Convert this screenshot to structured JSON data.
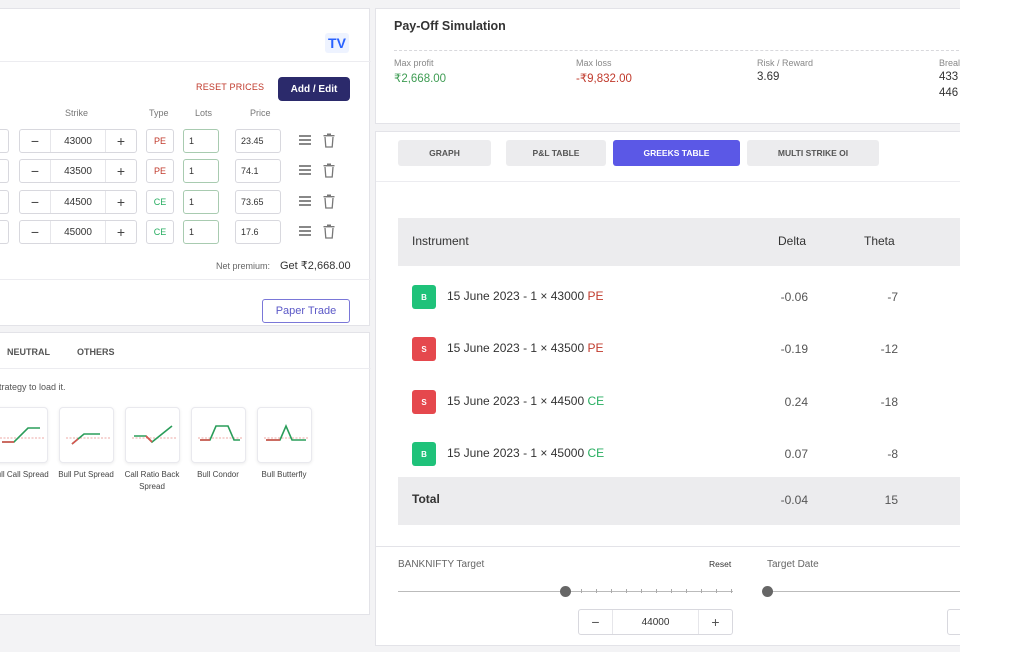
{
  "builder": {
    "reset_prices": "RESET PRICES",
    "add_edit": "Add / Edit",
    "columns": {
      "strike": "Strike",
      "type": "Type",
      "lots": "Lots",
      "price": "Price"
    },
    "legs": [
      {
        "strike": "43000",
        "type": "PE",
        "lots": "1",
        "price": "23.45"
      },
      {
        "strike": "43500",
        "type": "PE",
        "lots": "1",
        "price": "74.1"
      },
      {
        "strike": "44500",
        "type": "CE",
        "lots": "1",
        "price": "73.65"
      },
      {
        "strike": "45000",
        "type": "CE",
        "lots": "1",
        "price": "17.6"
      }
    ],
    "minus": "−",
    "plus": "+",
    "net_premium_label": "Net premium:",
    "net_premium_value": "Get ₹2,668.00",
    "paper_trade": "Paper Trade"
  },
  "strategies": {
    "tabs": [
      "NEUTRAL",
      "OTHERS"
    ],
    "hint": "trategy to load it.",
    "cards": [
      {
        "label": "Bull Call Spread",
        "icon": "bull-call-spread-icon"
      },
      {
        "label": "Bull Put Spread",
        "icon": "bull-put-spread-icon"
      },
      {
        "label": "Call Ratio Back Spread",
        "icon": "call-ratio-back-spread-icon"
      },
      {
        "label": "Bull Condor",
        "icon": "bull-condor-icon"
      },
      {
        "label": "Bull Butterfly",
        "icon": "bull-butterfly-icon"
      }
    ]
  },
  "payoff": {
    "title": "Pay-Off Simulation",
    "max_profit_label": "Max profit",
    "max_profit": "₹2,668.00",
    "max_loss_label": "Max loss",
    "max_loss": "-₹9,832.00",
    "risk_reward_label": "Risk / Reward",
    "risk_reward": "3.69",
    "breakeven_label": "Breal",
    "breakeven_1": "433",
    "breakeven_2": "446"
  },
  "tabs": [
    "GRAPH",
    "P&L TABLE",
    "GREEKS TABLE",
    "MULTI STRIKE OI"
  ],
  "active_tab": "GREEKS TABLE",
  "greeks": {
    "headers": {
      "instrument": "Instrument",
      "delta": "Delta",
      "theta": "Theta"
    },
    "rows": [
      {
        "side": "B",
        "text": "15 June 2023 - 1 × 43000 ",
        "type": "PE",
        "delta": "-0.06",
        "theta": "-7"
      },
      {
        "side": "S",
        "text": "15 June 2023 - 1 × 43500 ",
        "type": "PE",
        "delta": "-0.19",
        "theta": "-12"
      },
      {
        "side": "S",
        "text": "15 June 2023 - 1 × 44500 ",
        "type": "CE",
        "delta": "0.24",
        "theta": "-18"
      },
      {
        "side": "B",
        "text": "15 June 2023 - 1 × 45000 ",
        "type": "CE",
        "delta": "0.07",
        "theta": "-8"
      }
    ],
    "total": {
      "label": "Total",
      "delta": "-0.04",
      "theta": "15"
    }
  },
  "target": {
    "label": "BANKNIFTY Target",
    "reset": "Reset",
    "value": "44000",
    "minus": "−",
    "plus": "+",
    "date_label": "Target Date"
  },
  "colors": {
    "accent": "#5b58e6",
    "buy": "#1fc27a",
    "sell": "#e5484d",
    "pe": "#c0392b",
    "ce": "#27ae60"
  }
}
